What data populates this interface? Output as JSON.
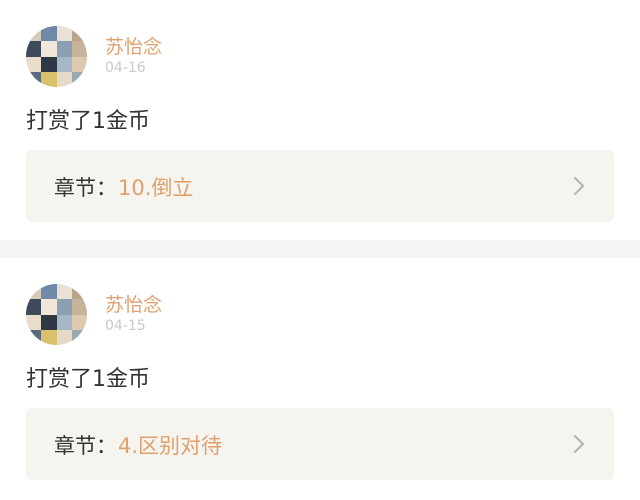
{
  "posts": [
    {
      "username": "苏怡念",
      "date": "04-16",
      "content": "打赏了1金币",
      "chapter_label": "章节：",
      "chapter_title": "10.倒立"
    },
    {
      "username": "苏怡念",
      "date": "04-15",
      "content": "打赏了1金币",
      "chapter_label": "章节：",
      "chapter_title": "4.区别对待"
    }
  ],
  "icons": {
    "avatar": "user-avatar-collage",
    "chevron": "chevron-right-icon"
  },
  "colors": {
    "accent": "#e0a06e",
    "text": "#333333",
    "muted": "#c9c9c9",
    "card_bg": "#f5f4ee",
    "divider_bg": "#f4f4f4"
  }
}
